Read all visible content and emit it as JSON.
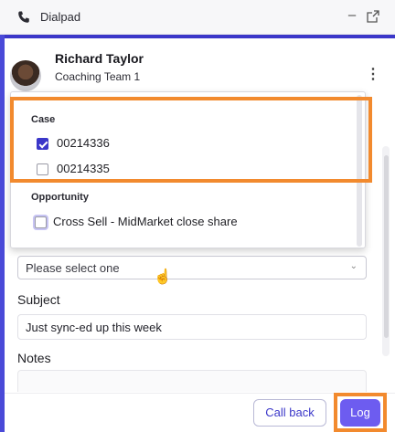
{
  "window": {
    "title": "Dialpad",
    "icons": {
      "phone": "phone-icon",
      "minimize": "minimize-icon",
      "popout": "popout-icon"
    }
  },
  "contact": {
    "name": "Richard Taylor",
    "team": "Coaching Team 1",
    "menu_icon": "more-vertical-icon"
  },
  "dropdown": {
    "groups": [
      {
        "label": "Case",
        "options": [
          {
            "label": "00214336",
            "checked": true
          },
          {
            "label": "00214335",
            "checked": false
          }
        ]
      },
      {
        "label": "Opportunity",
        "options": [
          {
            "label": "Cross Sell - MidMarket close share",
            "checked": false
          }
        ]
      }
    ]
  },
  "form": {
    "select_placeholder": "Please select one",
    "subject_label": "Subject",
    "subject_value": "Just sync-ed up this week",
    "notes_label": "Notes"
  },
  "footer": {
    "callback_label": "Call back",
    "log_label": "Log"
  },
  "colors": {
    "accent": "#3b37c9",
    "log_button": "#6d5cf0",
    "highlight": "#f28a2e"
  }
}
